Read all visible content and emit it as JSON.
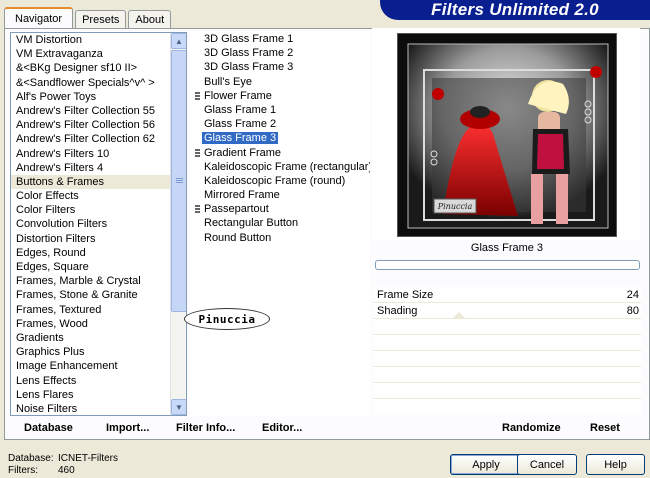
{
  "tabs": [
    {
      "label": "Navigator",
      "active": true
    },
    {
      "label": "Presets",
      "active": false
    },
    {
      "label": "About",
      "active": false
    }
  ],
  "title": "Filters Unlimited 2.0",
  "categories": [
    "VM Distortion",
    "VM Extravaganza",
    "&<BKg Designer sf10 II>",
    "&<Sandflower Specials^v^ >",
    "Alf's Power Toys",
    "Andrew's Filter Collection 55",
    "Andrew's Filter Collection 56",
    "Andrew's Filter Collection 62",
    "Andrew's Filters 10",
    "Andrew's Filters 4",
    "Buttons & Frames",
    "Color Effects",
    "Color Filters",
    "Convolution Filters",
    "Distortion Filters",
    "Edges, Round",
    "Edges, Square",
    "Frames, Marble & Crystal",
    "Frames, Stone & Granite",
    "Frames, Textured",
    "Frames, Wood",
    "Gradients",
    "Graphics Plus",
    "Image Enhancement",
    "Lens Effects",
    "Lens Flares",
    "Noise Filters"
  ],
  "selected_category": "Buttons & Frames",
  "filters": [
    {
      "label": "3D Glass Frame 1",
      "marker": false
    },
    {
      "label": "3D Glass Frame 2",
      "marker": false
    },
    {
      "label": "3D Glass Frame 3",
      "marker": false
    },
    {
      "label": "Bull's Eye",
      "marker": false
    },
    {
      "label": "Flower Frame",
      "marker": true
    },
    {
      "label": "Glass Frame 1",
      "marker": false
    },
    {
      "label": "Glass Frame 2",
      "marker": false
    },
    {
      "label": "Glass Frame 3",
      "marker": false
    },
    {
      "label": "Gradient Frame",
      "marker": true
    },
    {
      "label": "Kaleidoscopic Frame (rectangular)",
      "marker": false
    },
    {
      "label": "Kaleidoscopic Frame (round)",
      "marker": false
    },
    {
      "label": "Mirrored Frame",
      "marker": false
    },
    {
      "label": "Passepartout",
      "marker": true
    },
    {
      "label": "Rectangular Button",
      "marker": false
    },
    {
      "label": "Round Button",
      "marker": false
    }
  ],
  "selected_filter": "Glass Frame 3",
  "logo_text": "Pinuccia",
  "preview": {
    "signature": "Pinuccia"
  },
  "filter_name": "Glass Frame 3",
  "params": [
    {
      "name": "Frame Size",
      "value": "24"
    },
    {
      "name": "Shading",
      "value": "80"
    }
  ],
  "toolbar": {
    "database": "Database",
    "import": "Import...",
    "filter_info": "Filter Info...",
    "editor": "Editor...",
    "randomize": "Randomize",
    "reset": "Reset"
  },
  "footer": {
    "database_label": "Database:",
    "database_value": "ICNET-Filters",
    "filters_label": "Filters:",
    "filters_value": "460"
  },
  "buttons": {
    "apply": "Apply",
    "cancel": "Cancel",
    "help": "Help"
  },
  "colors": {
    "accent": "#316ac5",
    "banner": "#0a1f8f",
    "tab_highlight": "#e68b2c"
  }
}
